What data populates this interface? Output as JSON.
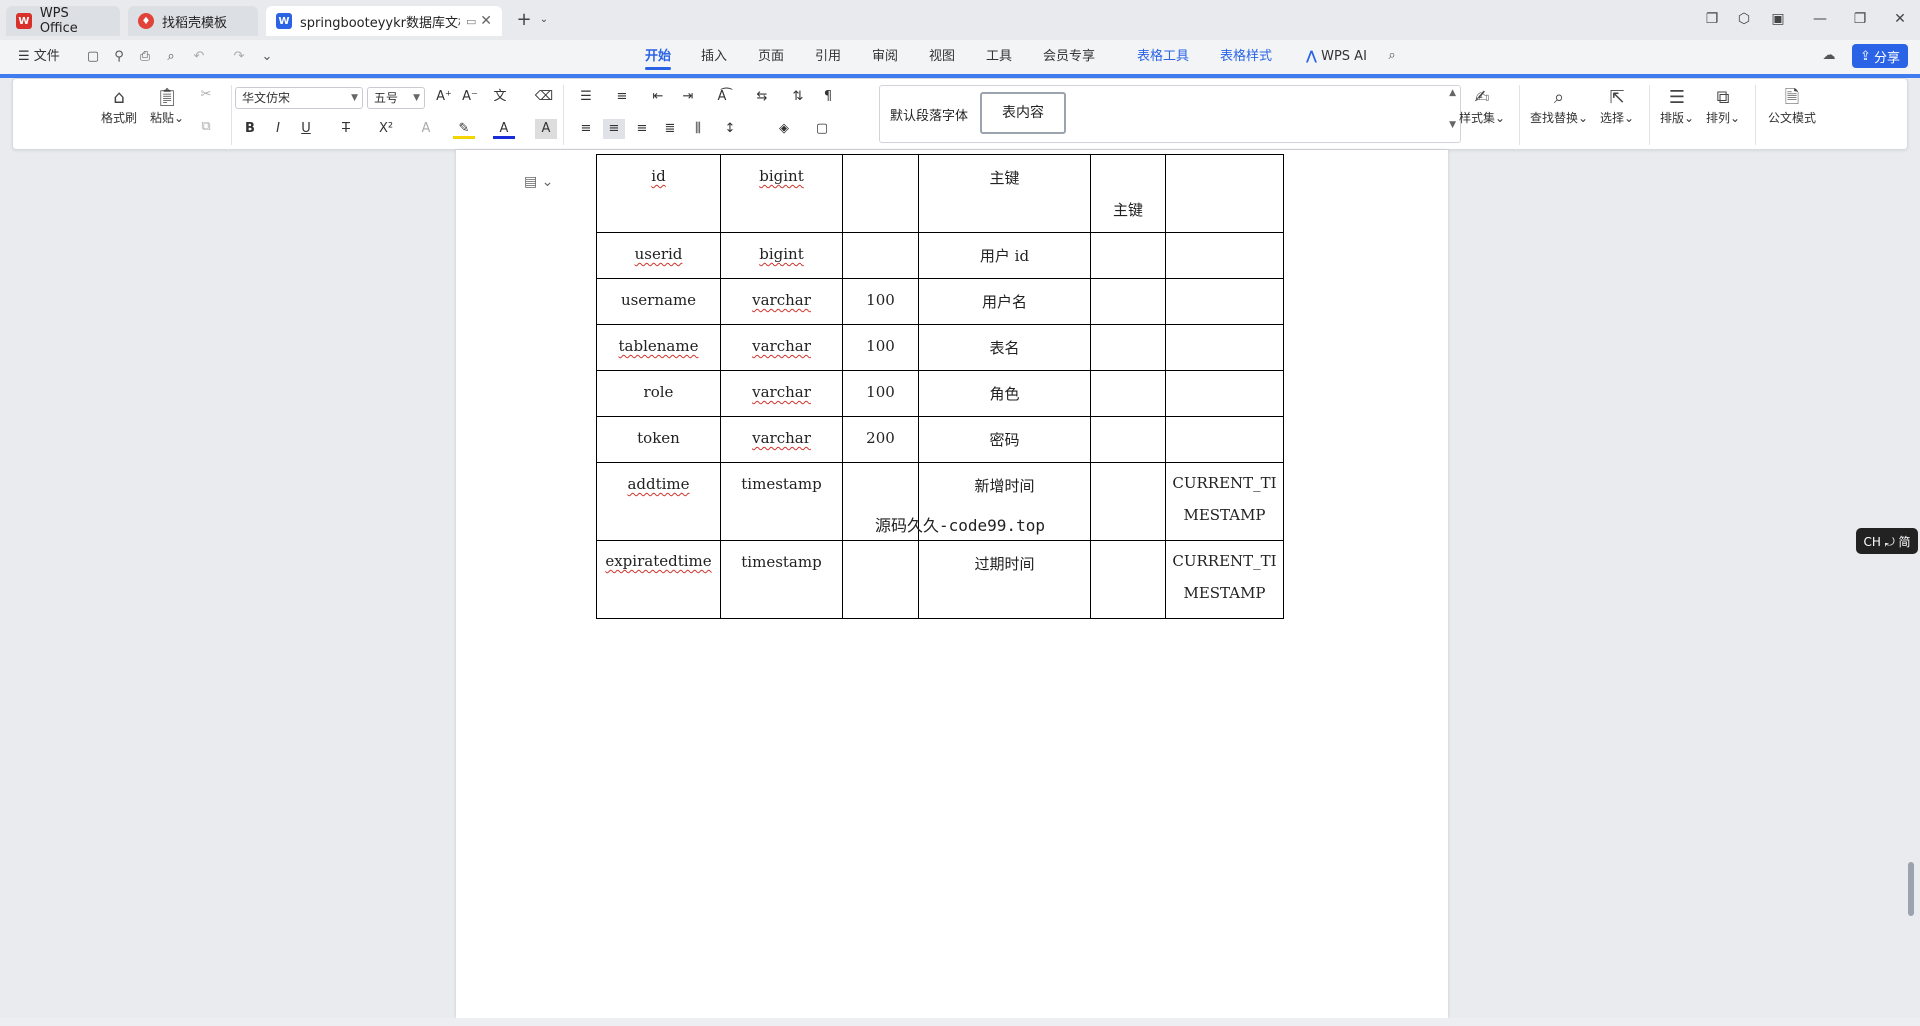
{
  "tabs": [
    {
      "label": "WPS Office",
      "icon": "wps-logo-icon"
    },
    {
      "label": "找稻壳模板",
      "icon": "docer-icon"
    },
    {
      "label": "springbooteyykr数据库文档",
      "icon": "word-doc-icon"
    }
  ],
  "menu": {
    "file": "文件",
    "items": [
      "开始",
      "插入",
      "页面",
      "引用",
      "审阅",
      "视图",
      "工具",
      "会员专享"
    ],
    "context_items": [
      "表格工具",
      "表格样式"
    ],
    "ai": "WPS AI",
    "share": "分享",
    "active": "开始"
  },
  "ribbon": {
    "format_painter": "格式刷",
    "paste": "粘贴",
    "font_name": "华文仿宋",
    "font_size": "五号",
    "style_default": "默认段落字体",
    "style_table": "表内容",
    "style_set": "样式集",
    "find_replace": "查找替换",
    "select": "选择",
    "layout": "排版",
    "arrange": "排列",
    "official_mode": "公文模式"
  },
  "table": {
    "rows": [
      [
        "id",
        "bigint",
        "",
        "主键",
        "主键",
        ""
      ],
      [
        "userid",
        "bigint",
        "",
        "用户 id",
        "",
        ""
      ],
      [
        "username",
        "varchar",
        "100",
        "用户名",
        "",
        ""
      ],
      [
        "tablename",
        "varchar",
        "100",
        "表名",
        "",
        ""
      ],
      [
        "role",
        "varchar",
        "100",
        "角色",
        "",
        ""
      ],
      [
        "token",
        "varchar",
        "200",
        "密码",
        "",
        ""
      ],
      [
        "addtime",
        "timestamp",
        "",
        "新增时间",
        "",
        "CURRENT_TIMESTAMP"
      ],
      [
        "expiratedtime",
        "timestamp",
        "",
        "过期时间",
        "",
        "CURRENT_TIMESTAMP"
      ]
    ]
  },
  "watermark": "源码久久-code99.top",
  "ime": "CH ⤾ 简",
  "colors": {
    "accent": "#2a63e6",
    "wavy": "#d0342c"
  }
}
